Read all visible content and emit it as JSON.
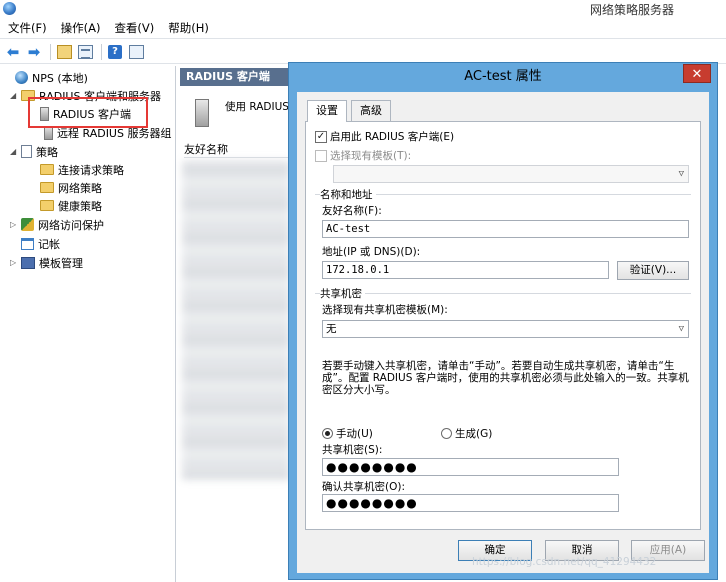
{
  "window": {
    "title": "网络策略服务器"
  },
  "menu": [
    "文件(F)",
    "操作(A)",
    "查看(V)",
    "帮助(H)"
  ],
  "toolbar": [
    "back-arrow-icon",
    "forward-arrow-icon",
    "up-folder-icon",
    "properties-icon",
    "help-icon",
    "show-hide-icon"
  ],
  "tree": [
    {
      "label": "NPS (本地)",
      "icon": "globe-icon",
      "expander": ""
    },
    {
      "label": "RADIUS 客户端和服务器",
      "icon": "folder-icon",
      "expander": "◢"
    },
    {
      "label": "RADIUS 客户端",
      "icon": "server-icon",
      "expander": ""
    },
    {
      "label": "远程 RADIUS 服务器组",
      "icon": "server-icon",
      "expander": ""
    },
    {
      "label": "策略",
      "icon": "doc-icon",
      "expander": "◢"
    },
    {
      "label": "连接请求策略",
      "icon": "folder-icon",
      "expander": ""
    },
    {
      "label": "网络策略",
      "icon": "folder-icon",
      "expander": ""
    },
    {
      "label": "健康策略",
      "icon": "folder-icon",
      "expander": ""
    },
    {
      "label": "网络访问保护",
      "icon": "shield-icon",
      "expander": "▷"
    },
    {
      "label": "记帐",
      "icon": "log-icon",
      "expander": ""
    },
    {
      "label": "模板管理",
      "icon": "template-icon",
      "expander": "▷"
    }
  ],
  "middle": {
    "header": "RADIUS 客户端",
    "description": "使用 RADIUS",
    "column": "友好名称"
  },
  "dialog": {
    "title": "AC-test 属性",
    "tabs": [
      "设置",
      "高级"
    ],
    "enable_checkbox": "启用此 RADIUS 客户端(E)",
    "template_checkbox": "选择现有模板(T):",
    "name_group": "名称和地址",
    "friendly_label": "友好名称(F):",
    "friendly_value": "AC-test",
    "address_label": "地址(IP 或 DNS)(D):",
    "address_value": "172.18.0.1",
    "verify_button": "验证(V)...",
    "secret_group": "共享机密",
    "secret_template_label": "选择现有共享机密模板(M):",
    "secret_template_value": "无",
    "description": "若要手动键入共享机密，请单击“手动”。若要自动生成共享机密，请单击“生成”。配置 RADIUS 客户端时，使用的共享机密必须与此处输入的一致。共享机密区分大小写。",
    "radio_manual": "手动(U)",
    "radio_generate": "生成(G)",
    "secret_label": "共享机密(S):",
    "secret_value": "●●●●●●●●",
    "confirm_label": "确认共享机密(O):",
    "confirm_value": "●●●●●●●●",
    "ok": "确定",
    "cancel": "取消",
    "apply": "应用(A)"
  },
  "watermark": "https://blog.csdn.net/qq_41294432"
}
